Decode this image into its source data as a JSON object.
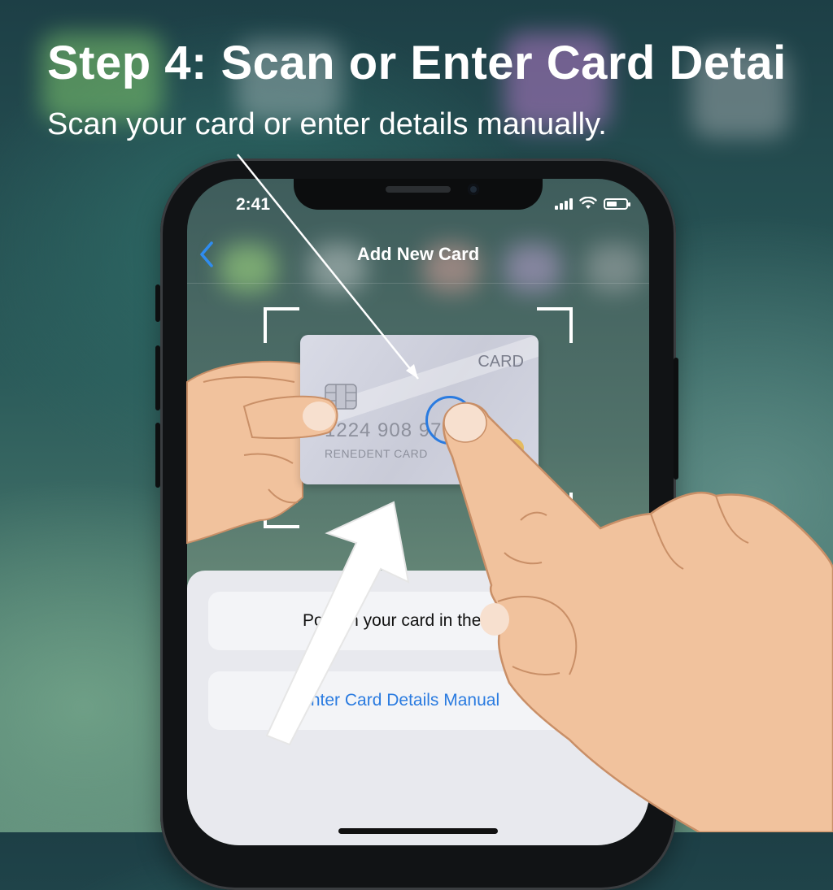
{
  "header": {
    "title": "Step 4: Scan or Enter Card Detai",
    "subtitle": "Scan your card or enter details manually."
  },
  "status_bar": {
    "time": "2:41"
  },
  "nav": {
    "back_icon": "chevron-left-icon",
    "title": "Add New Card"
  },
  "card": {
    "brand": "CARD",
    "number": "1224 908 97    4",
    "holder": "RENEDENT CARD"
  },
  "sheet": {
    "position_hint": "Positi    n your card in the fr",
    "manual_label": "Enter Card Details Manual"
  },
  "colors": {
    "accent": "#2a7be0",
    "skin": "#f1c29d",
    "sheet": "#e8e9ee"
  }
}
